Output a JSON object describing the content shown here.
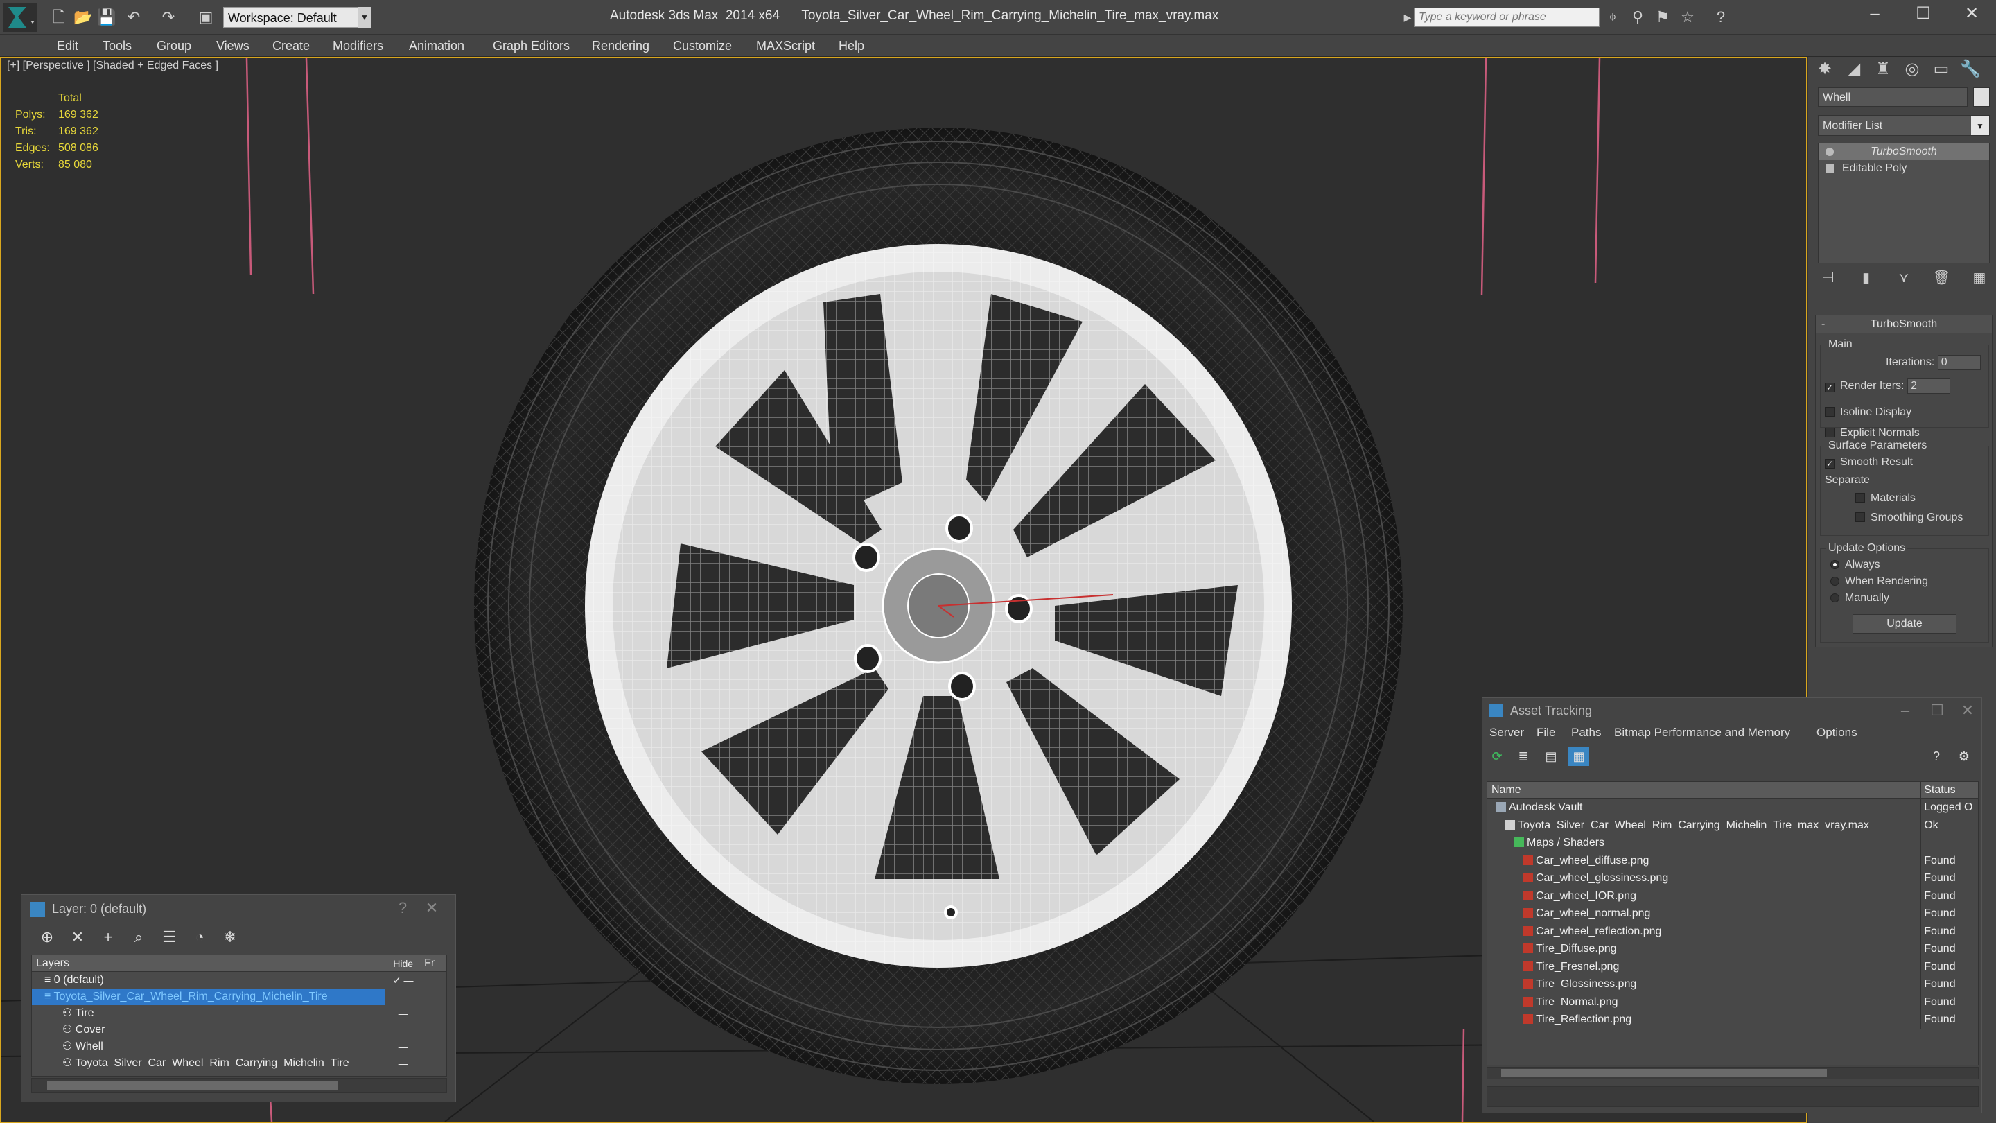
{
  "app": {
    "window_title": "Autodesk 3ds Max  2014 x64      Toyota_Silver_Car_Wheel_Rim_Carrying_Michelin_Tire_max_vray.max",
    "workspace": "Workspace: Default",
    "search_placeholder": "Type a keyword or phrase"
  },
  "menu": [
    "Edit",
    "Tools",
    "Group",
    "Views",
    "Create",
    "Modifiers",
    "Animation",
    "Graph Editors",
    "Rendering",
    "Customize",
    "MAXScript",
    "Help"
  ],
  "viewport": {
    "label": "[+] [Perspective ] [Shaded + Edged Faces ]",
    "stats": {
      "header": "Total",
      "rows": [
        {
          "k": "Polys:",
          "v": "169 362"
        },
        {
          "k": "Tris:",
          "v": "169 362"
        },
        {
          "k": "Edges:",
          "v": "508 086"
        },
        {
          "k": "Verts:",
          "v": "85 080"
        }
      ]
    }
  },
  "command_panel": {
    "object_name": "Whell",
    "modifier_list": "Modifier List",
    "stack": [
      "TurboSmooth",
      "Editable Poly"
    ],
    "rollout": {
      "title": "TurboSmooth",
      "main_group": "Main",
      "iterations_label": "Iterations:",
      "iterations": "0",
      "render_iters_label": "Render Iters:",
      "render_iters": "2",
      "isoline": "Isoline Display",
      "explicit": "Explicit Normals",
      "surface_group": "Surface Parameters",
      "smooth_result": "Smooth Result",
      "separate": "Separate",
      "materials": "Materials",
      "smoothing_groups": "Smoothing Groups",
      "update_group": "Update Options",
      "always": "Always",
      "when_rendering": "When Rendering",
      "manually": "Manually",
      "update_button": "Update"
    }
  },
  "asset_tracking": {
    "title": "Asset Tracking",
    "menu": [
      "Server",
      "File",
      "Paths",
      "Bitmap Performance and Memory",
      "Options"
    ],
    "col_name": "Name",
    "col_status": "Status",
    "rows": [
      {
        "name": "Autodesk Vault",
        "status": "Logged O",
        "indent": 1,
        "kind": "vault"
      },
      {
        "name": "Toyota_Silver_Car_Wheel_Rim_Carrying_Michelin_Tire_max_vray.max",
        "status": "Ok",
        "indent": 2,
        "kind": "file"
      },
      {
        "name": "Maps / Shaders",
        "status": "",
        "indent": 3,
        "kind": "folder"
      },
      {
        "name": "Car_wheel_diffuse.png",
        "status": "Found",
        "indent": 4,
        "kind": "map"
      },
      {
        "name": "Car_wheel_glossiness.png",
        "status": "Found",
        "indent": 4,
        "kind": "map"
      },
      {
        "name": "Car_wheel_IOR.png",
        "status": "Found",
        "indent": 4,
        "kind": "map"
      },
      {
        "name": "Car_wheel_normal.png",
        "status": "Found",
        "indent": 4,
        "kind": "map"
      },
      {
        "name": "Car_wheel_reflection.png",
        "status": "Found",
        "indent": 4,
        "kind": "map"
      },
      {
        "name": "Tire_Diffuse.png",
        "status": "Found",
        "indent": 4,
        "kind": "map"
      },
      {
        "name": "Tire_Fresnel.png",
        "status": "Found",
        "indent": 4,
        "kind": "map"
      },
      {
        "name": "Tire_Glossiness.png",
        "status": "Found",
        "indent": 4,
        "kind": "map"
      },
      {
        "name": "Tire_Normal.png",
        "status": "Found",
        "indent": 4,
        "kind": "map"
      },
      {
        "name": "Tire_Reflection.png",
        "status": "Found",
        "indent": 4,
        "kind": "map"
      }
    ]
  },
  "layer_panel": {
    "title": "Layer: 0 (default)",
    "col_layers": "Layers",
    "col_hide": "Hide",
    "col_fr": "Fr",
    "rows": [
      {
        "name": "0 (default)",
        "indent": 1,
        "selected": false,
        "checked": true
      },
      {
        "name": "Toyota_Silver_Car_Wheel_Rim_Carrying_Michelin_Tire",
        "indent": 1,
        "selected": true,
        "checked": false
      },
      {
        "name": "Tire",
        "indent": 2,
        "selected": false,
        "checked": false
      },
      {
        "name": "Cover",
        "indent": 2,
        "selected": false,
        "checked": false
      },
      {
        "name": "Whell",
        "indent": 2,
        "selected": false,
        "checked": false
      },
      {
        "name": "Toyota_Silver_Car_Wheel_Rim_Carrying_Michelin_Tire",
        "indent": 2,
        "selected": false,
        "checked": false
      }
    ]
  },
  "colors": {
    "accent_viewport_border": "#d9a71e",
    "stats_text": "#e7d83a",
    "selection": "#2f78c8",
    "map_icon": "#c0392b"
  }
}
